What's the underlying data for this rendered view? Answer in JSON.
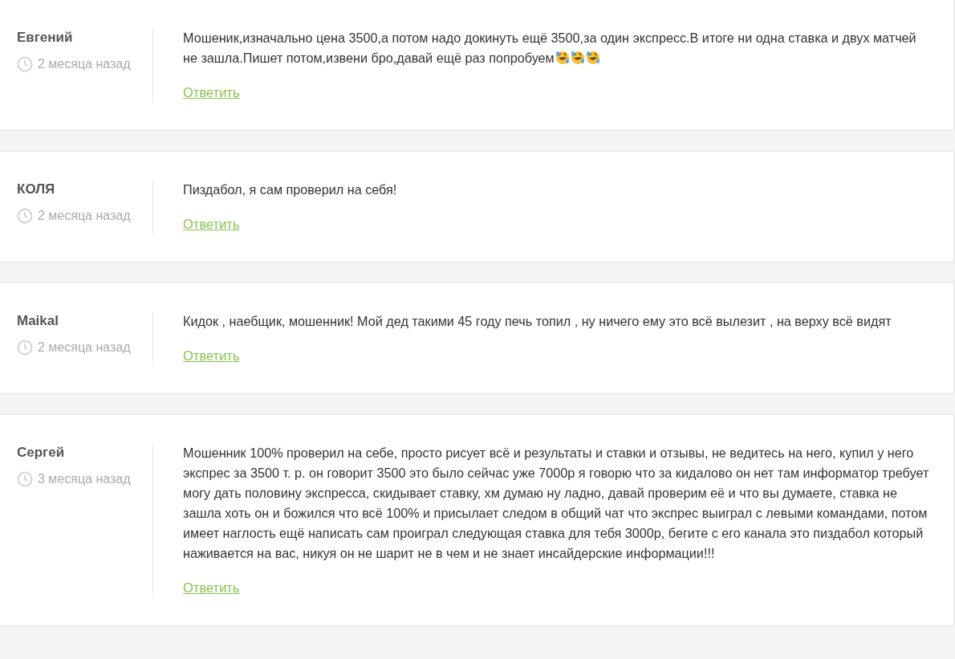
{
  "comments": [
    {
      "author": "Евгений",
      "time": "2 месяца назад",
      "text": "Мошеник,изначально цена 3500,а потом надо докинуть ещё 3500,за один экспресс.В итоге ни одна ставка и двух матчей не зашла.Пишет потом,извени бро,давай ещё раз попробуем",
      "emojis": [
        {
          "kind": "rolling-laugh"
        },
        {
          "kind": "rolling-laugh"
        },
        {
          "kind": "rolling-laugh"
        }
      ],
      "reply": "Ответить"
    },
    {
      "author": "КОЛЯ",
      "time": "2 месяца назад",
      "text": "Пиздабол, я сам проверил на себя!",
      "reply": "Ответить"
    },
    {
      "author": "Maikal",
      "time": "2 месяца назад",
      "text": "Кидок , наебщик, мошенник! Мой дед такими 45 году печь топил , ну ничего ему это всё вылезит , на верху всё видят",
      "reply": "Ответить"
    },
    {
      "author": "Сергей",
      "time": "3 месяца назад",
      "text": "Мошенник 100% проверил на себе, просто рисует всё и результаты и ставки и отзывы, не ведитесь на него, купил у него экспрес за 3500 т. р. он говорит 3500 это было сейчас уже 7000р я говорю что за кидалово он нет там информатор требует могу дать половину экспресса, скидывает ставку, хм думаю ну ладно, давай проверим её и что вы думаете, ставка не зашла хоть он и божился что всё 100% и присылает следом в общий чат что экспрес выиграл с левыми командами, потом имеет наглость ещё написать сам проиграл следующая ставка для тебя 3000р, бегите с его канала это пиздабол который наживается на вас, никуя он не шарит не в чем и не знает инсайдерские информации!!!",
      "reply": "Ответить"
    }
  ]
}
